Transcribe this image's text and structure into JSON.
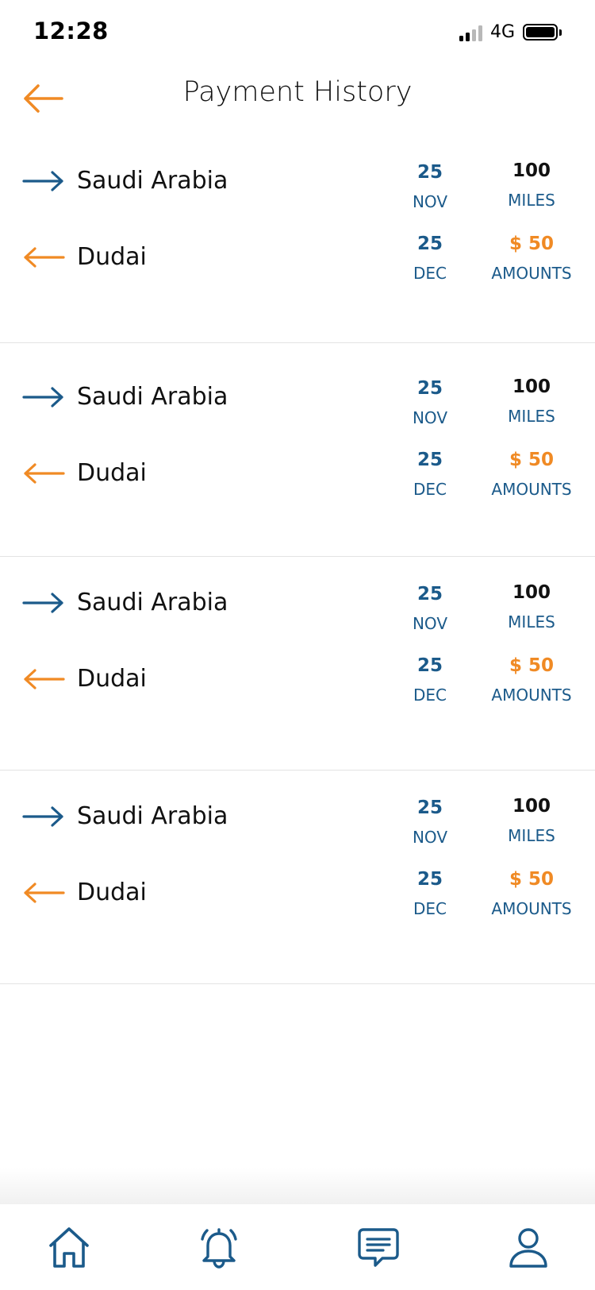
{
  "status_bar": {
    "time": "12:28",
    "network": "4G"
  },
  "header": {
    "title": "Payment History",
    "back_icon": "arrow-left-icon"
  },
  "colors": {
    "blue": "#1b5a8a",
    "orange": "#f08a24",
    "text": "#111111"
  },
  "trips": [
    {
      "from": {
        "place": "Saudi Arabia",
        "day": "25",
        "month": "NOV",
        "value": "100",
        "unit": "MILES"
      },
      "to": {
        "place": "Dudai",
        "day": "25",
        "month": "DEC",
        "value": "$ 50",
        "unit": "AMOUNTS"
      }
    },
    {
      "from": {
        "place": "Saudi Arabia",
        "day": "25",
        "month": "NOV",
        "value": "100",
        "unit": "MILES"
      },
      "to": {
        "place": "Dudai",
        "day": "25",
        "month": "DEC",
        "value": "$ 50",
        "unit": "AMOUNTS"
      }
    },
    {
      "from": {
        "place": "Saudi Arabia",
        "day": "25",
        "month": "NOV",
        "value": "100",
        "unit": "MILES"
      },
      "to": {
        "place": "Dudai",
        "day": "25",
        "month": "DEC",
        "value": "$ 50",
        "unit": "AMOUNTS"
      }
    },
    {
      "from": {
        "place": "Saudi Arabia",
        "day": "25",
        "month": "NOV",
        "value": "100",
        "unit": "MILES"
      },
      "to": {
        "place": "Dudai",
        "day": "25",
        "month": "DEC",
        "value": "$ 50",
        "unit": "AMOUNTS"
      }
    }
  ],
  "tabbar": {
    "items": [
      {
        "name": "home",
        "icon": "home-icon"
      },
      {
        "name": "notifications",
        "icon": "bell-icon"
      },
      {
        "name": "messages",
        "icon": "chat-icon"
      },
      {
        "name": "profile",
        "icon": "user-icon"
      }
    ]
  }
}
